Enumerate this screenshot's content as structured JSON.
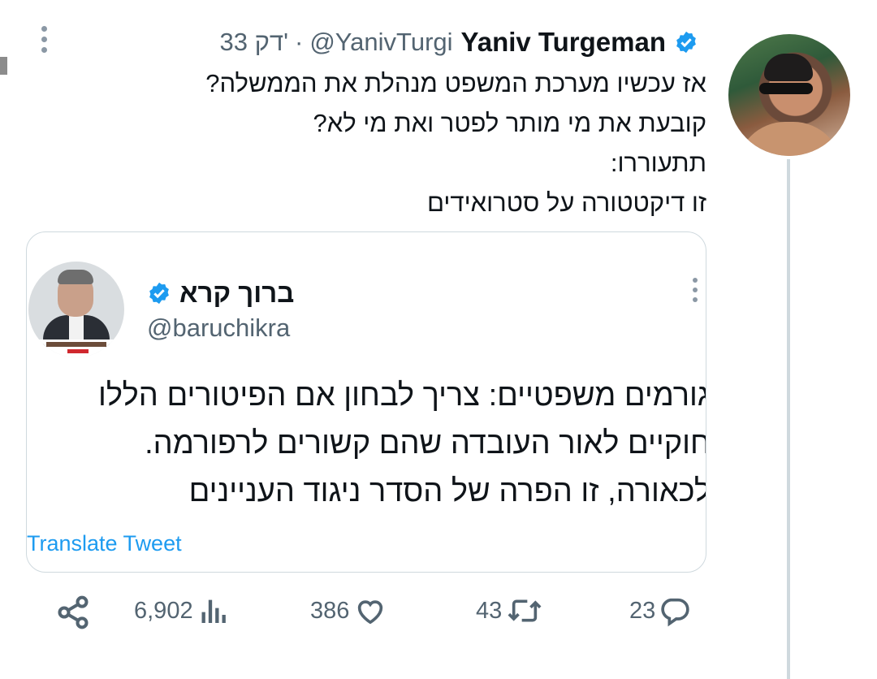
{
  "tweet": {
    "author_name": "Yaniv Turgeman",
    "handle": "@YanivTurgi",
    "separator": "·",
    "time": "33 דק'",
    "lines": [
      "אז עכשיו מערכת המשפט מנהלת את הממשלה?",
      "קובעת את מי מותר לפטר ואת מי לא?",
      "תתעוררו:",
      "זו דיקטטורה על סטרואידים"
    ]
  },
  "quote": {
    "author_name": "ברוך קרא",
    "handle": "@baruchikra",
    "lines": [
      "גורמים משפטיים: צריך לבחון אם הפיטורים הללו",
      "חוקיים לאור העובדה שהם קשורים לרפורמה.",
      "לכאורה, זו הפרה של הסדר ניגוד העניינים"
    ],
    "translate_label": "Translate Tweet"
  },
  "actions": {
    "replies": "23",
    "retweets": "43",
    "likes": "386",
    "views": "6,902"
  },
  "icons": {
    "verified": "verified-badge-icon",
    "more": "more-vertical-icon",
    "reply": "reply-icon",
    "retweet": "retweet-icon",
    "like": "heart-icon",
    "views": "views-icon",
    "share": "share-icon"
  },
  "colors": {
    "accent": "#1d9bf0",
    "secondary_text": "#536471",
    "border": "#cfd9de"
  }
}
